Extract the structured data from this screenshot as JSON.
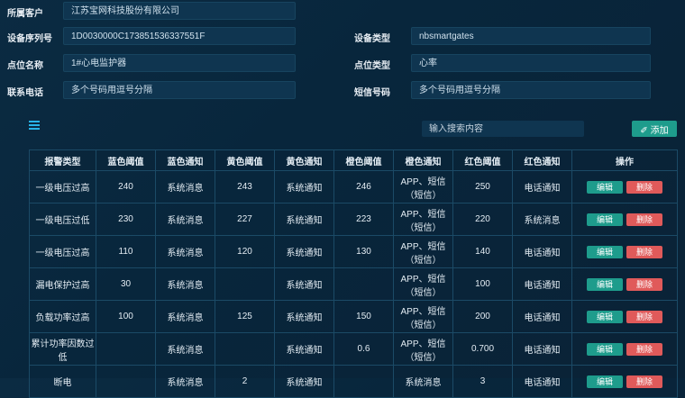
{
  "form": {
    "customer_label": "所属客户",
    "customer_value": "江苏宝网科技股份有限公司",
    "serial_label": "设备序列号",
    "serial_value": "1D0030000C173851536337551F",
    "device_type_label": "设备类型",
    "device_type_value": "nbsmartgates",
    "monitor_name_label": "点位名称",
    "monitor_name_value": "1#心电监护器",
    "monitor_type_label": "点位类型",
    "monitor_type_value": "心率",
    "alarm_contact_label": "联系电话",
    "alarm_contact_value": "多个号码用逗号分隔",
    "alarm_sms_label": "短信号码",
    "alarm_sms_value": "多个号码用逗号分隔"
  },
  "toolbar": {
    "search_placeholder": "输入搜索内容",
    "add_label": "✐ 添加"
  },
  "table": {
    "headers": [
      "报警类型",
      "蓝色阈值",
      "蓝色通知",
      "黄色阈值",
      "黄色通知",
      "橙色阈值",
      "橙色通知",
      "红色阈值",
      "红色通知",
      "操作"
    ],
    "edit_label": "编辑",
    "delete_label": "删除",
    "rows": [
      [
        "一级电压过高",
        "240",
        "系统消息",
        "243",
        "系统通知",
        "246",
        "APP、短信（短信）",
        "250",
        "电话通知"
      ],
      [
        "一级电压过低",
        "230",
        "系统消息",
        "227",
        "系统通知",
        "223",
        "APP、短信（短信）",
        "220",
        "系统消息"
      ],
      [
        "一级电压过高",
        "110",
        "系统消息",
        "120",
        "系统通知",
        "130",
        "APP、短信（短信）",
        "140",
        "电话通知"
      ],
      [
        "漏电保护过高",
        "30",
        "系统消息",
        "",
        "系统通知",
        "",
        "APP、短信（短信）",
        "100",
        "电话通知"
      ],
      [
        "负载功率过高",
        "100",
        "系统消息",
        "125",
        "系统通知",
        "150",
        "APP、短信（短信）",
        "200",
        "电话通知"
      ],
      [
        "累计功率因数过低",
        "",
        "系统消息",
        "",
        "系统通知",
        "0.6",
        "APP、短信（短信）",
        "0.700",
        "电话通知"
      ],
      [
        "断电",
        "",
        "系统消息",
        "2",
        "系统通知",
        "",
        "系统消息",
        "3",
        "电话通知"
      ]
    ]
  }
}
